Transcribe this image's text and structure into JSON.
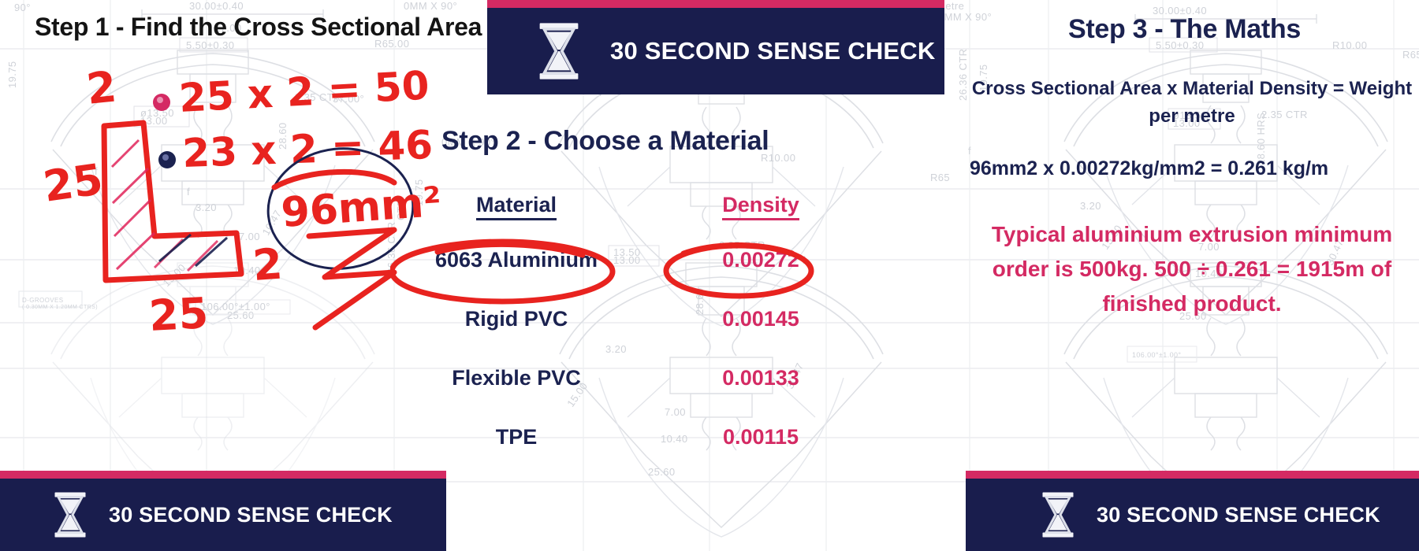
{
  "banners": [
    {
      "id": "top",
      "icon": "hourglass-icon",
      "label": "30 SECOND SENSE CHECK"
    },
    {
      "id": "bottom_left",
      "icon": "hourglass-icon",
      "label": "30 SECOND SENSE CHECK"
    },
    {
      "id": "bottom_right",
      "icon": "hourglass-icon",
      "label": "30 SECOND SENSE CHECK"
    }
  ],
  "colors": {
    "navy": "#191d4d",
    "pink": "#d42a63",
    "red_ink": "#e8231f",
    "navy_ink": "#1b2250",
    "blueprint_line": "#d8dae0"
  },
  "step1": {
    "title": "Step 1 - Find the Cross Sectional Area",
    "annotations": {
      "calc_1": "25 x 2 = 50",
      "calc_2": "23 x 2 = 46",
      "result": "96mm2",
      "dim_top": "2",
      "dim_left": "25",
      "dim_right": "2",
      "dim_bottom": "25"
    }
  },
  "step2": {
    "title": "Step 2 - Choose a Material",
    "headers": {
      "material": "Material",
      "density": "Density"
    },
    "rows": [
      {
        "material": "6063 Aluminium",
        "density": "0.00272",
        "highlighted": true
      },
      {
        "material": "Rigid PVC",
        "density": "0.00145",
        "highlighted": false
      },
      {
        "material": "Flexible PVC",
        "density": "0.00133",
        "highlighted": false
      },
      {
        "material": "TPE",
        "density": "0.00115",
        "highlighted": false
      }
    ]
  },
  "step3": {
    "title": "Step 3 - The Maths",
    "formula": "Cross Sectional Area x Material Density = Weight per metre",
    "calculation": "96mm2  x 0.00272kg/mm2 = 0.261 kg/m",
    "note": "Typical aluminium extrusion minimum order is 500kg. 500 ÷ 0.261 = 1915m of finished product."
  },
  "blueprint_labels": [
    "30.00±0.40",
    "5.50±0.30",
    "17.00",
    "R65.00",
    "R10.00",
    "19.75",
    "26.36 CTR",
    "2.35 CTR",
    "28.60",
    "13.50",
    "13.00",
    "3.20",
    "7.00",
    "10.40",
    "25.60",
    "15.00",
    "30.47",
    "37.00°",
    "90°",
    "0MM X 90°",
    "106.00°±1.00°",
    "f"
  ]
}
